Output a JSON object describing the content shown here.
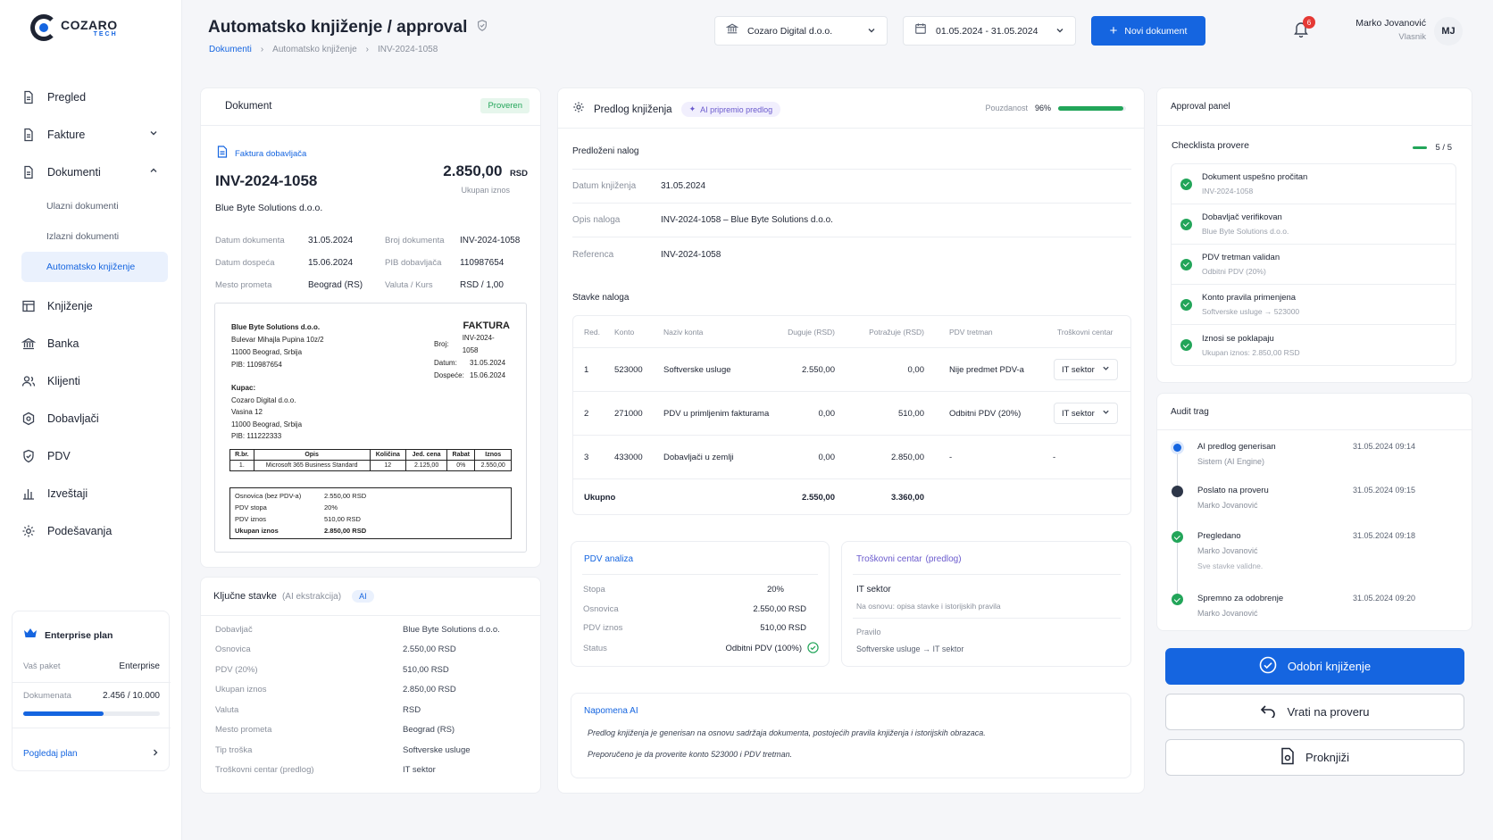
{
  "brand": {
    "name": "COZARO",
    "sub": "TECH"
  },
  "sidebar": {
    "items": [
      {
        "label": "Pregled",
        "icon": "file-icon"
      },
      {
        "label": "Fakture",
        "icon": "file-icon"
      },
      {
        "label": "Dokumenti",
        "icon": "file-icon"
      },
      {
        "label": "Knjiženje",
        "icon": "ledger-icon"
      },
      {
        "label": "Banka",
        "icon": "bank-icon"
      },
      {
        "label": "Klijenti",
        "icon": "users-icon"
      },
      {
        "label": "Dobavljači",
        "icon": "supplier-icon"
      },
      {
        "label": "PDV",
        "icon": "shield-icon"
      },
      {
        "label": "Izveštaji",
        "icon": "chart-icon"
      },
      {
        "label": "Podešavanja",
        "icon": "gear-icon"
      }
    ],
    "sub": [
      "Ulazni dokumenti",
      "Izlazni dokumenti",
      "Automatsko knjiženje"
    ],
    "plan": {
      "title": "Enterprise plan",
      "pkg_label": "Vaš paket",
      "pkg_value": "Enterprise",
      "docs_label": "Dokumenata",
      "docs_value": "2.456 / 10.000",
      "docs_fraction": 0.2456,
      "link": "Pogledaj plan"
    }
  },
  "header": {
    "title": "Automatsko knjiženje / approval",
    "breadcrumb": [
      "Dokumenti",
      "Automatsko knjiženje",
      "INV-2024-1058"
    ],
    "company": "Cozaro Digital d.o.o.",
    "period": "01.05.2024 - 31.05.2024",
    "new_doc": "Novi dokument",
    "notif_count": "6",
    "user_name": "Marko Jovanović",
    "user_role": "Vlasnik",
    "user_initials": "MJ"
  },
  "doc": {
    "title": "Dokument",
    "badge": "Proveren",
    "type": "Faktura dobavljača",
    "number": "INV-2024-1058",
    "amount": "2.850,00",
    "currency": "RSD",
    "amount_label": "Ukupan iznos",
    "supplier": "Blue Byte Solutions d.o.o.",
    "fields": [
      [
        "Datum dokumenta",
        "31.05.2024",
        "Broj dokumenta",
        "INV-2024-1058"
      ],
      [
        "Datum dospeća",
        "15.06.2024",
        "PIB dobavljača",
        "110987654"
      ],
      [
        "Mesto prometa",
        "Beograd (RS)",
        "Valuta / Kurs",
        "RSD / 1,00"
      ]
    ],
    "invoice": {
      "seller": "Blue Byte Solutions d.o.o.",
      "addr1": "Bulevar Mihajla Pupina 10z/2",
      "addr2": "11000 Beograd, Srbija",
      "pib": "PIB: 110987654",
      "title": "FAKTURA",
      "meta": [
        [
          "Broj:",
          "INV-2024-1058"
        ],
        [
          "Datum:",
          "31.05.2024"
        ],
        [
          "Dospeće:",
          "15.06.2024"
        ]
      ],
      "buyer_label": "Kupac:",
      "buyer": "Cozaro Digital d.o.o.",
      "baddr1": "Vasina 12",
      "baddr2": "11000 Beograd, Srbija",
      "bpib": "PIB: 111222333",
      "cols": [
        "R.br.",
        "Opis",
        "Količina",
        "Jed. cena",
        "Rabat",
        "Iznos"
      ],
      "row": [
        "1.",
        "Microsoft 365 Business Standard",
        "12",
        "2.125,00",
        "0%",
        "2.550,00"
      ],
      "totals": [
        [
          "Osnovica (bez PDV-a)",
          "2.550,00  RSD"
        ],
        [
          "PDV stopa",
          "20%"
        ],
        [
          "PDV iznos",
          "510,00  RSD"
        ],
        [
          "Ukupan iznos",
          "2.850,00  RSD"
        ]
      ]
    }
  },
  "key": {
    "title": "Ključne stavke",
    "sub": "(AI ekstrakcija)",
    "badge": "AI",
    "rows": [
      [
        "Dobavljač",
        "Blue Byte Solutions d.o.o."
      ],
      [
        "Osnovica",
        "2.550,00  RSD"
      ],
      [
        "PDV (20%)",
        "510,00  RSD"
      ],
      [
        "Ukupan iznos",
        "2.850,00  RSD"
      ],
      [
        "Valuta",
        "RSD"
      ],
      [
        "Mesto prometa",
        "Beograd (RS)"
      ],
      [
        "Tip troška",
        "Softverske usluge"
      ],
      [
        "Troškovni centar (predlog)",
        "IT sektor"
      ]
    ]
  },
  "proposal": {
    "title": "Predlog knjiženja",
    "ai_badge": "AI pripremio predlog",
    "conf_label": "Pouzdanost",
    "conf_value": "96%",
    "conf_fraction": 0.96,
    "order_title": "Predloženi nalog",
    "order": [
      [
        "Datum knjiženja",
        "31.05.2024"
      ],
      [
        "Opis naloga",
        "INV-2024-1058 – Blue Byte Solutions d.o.o."
      ],
      [
        "Referenca",
        "INV-2024-1058"
      ]
    ],
    "items_title": "Stavke naloga",
    "cols": [
      "Red.",
      "Konto",
      "Naziv konta",
      "Duguje  (RSD)",
      "Potražuje  (RSD)",
      "PDV tretman",
      "Troškovni centar"
    ],
    "rows": [
      [
        "1",
        "523000",
        "Softverske usluge",
        "2.550,00",
        "0,00",
        "Nije predmet PDV-a",
        "IT sektor"
      ],
      [
        "2",
        "271000",
        "PDV u primljenim fakturama",
        "0,00",
        "510,00",
        "Odbitni PDV (20%)",
        "IT sektor"
      ],
      [
        "3",
        "433000",
        "Dobavljači u zemlji",
        "0,00",
        "2.850,00",
        "-",
        "-"
      ]
    ],
    "total_label": "Ukupno",
    "total_debit": "2.550,00",
    "total_credit": "3.360,00"
  },
  "vat": {
    "title": "PDV analiza",
    "rows": [
      [
        "Stopa",
        "20%"
      ],
      [
        "Osnovica",
        "2.550,00  RSD"
      ],
      [
        "PDV iznos",
        "510,00  RSD"
      ],
      [
        "Status",
        "Odbitni PDV (100%)"
      ]
    ]
  },
  "cost": {
    "title": "Troškovni centar",
    "title_sub": "(predlog)",
    "name": "IT sektor",
    "basis": "Na osnovu: opisa stavke i istorijskih pravila",
    "rule_label": "Pravilo",
    "rule": "Softverske usluge → IT sektor"
  },
  "note": {
    "title": "Napomena AI",
    "l1": "Predlog knjiženja je generisan na osnovu sadržaja dokumenta, postojećih pravila knjiženja i istorijskih obrazaca.",
    "l2": "Preporučeno je da proverite konto 523000 i PDV tretman."
  },
  "approval": {
    "title": "Approval panel",
    "checklist": "Checklista provere",
    "count": "5 / 5",
    "checks": [
      [
        "Dokument uspešno pročitan",
        "INV-2024-1058"
      ],
      [
        "Dobavljač verifikovan",
        "Blue Byte Solutions d.o.o."
      ],
      [
        "PDV tretman validan",
        "Odbitni PDV (20%)"
      ],
      [
        "Konto pravila primenjena",
        "Softverske usluge → 523000"
      ],
      [
        "Iznosi se poklapaju",
        "Ukupan iznos: 2.850,00 RSD"
      ]
    ]
  },
  "audit": {
    "title": "Audit trag",
    "events": [
      {
        "t": "AI predlog generisan",
        "s": "Sistem (AI Engine)",
        "d": "31.05.2024  09:14",
        "n": ""
      },
      {
        "t": "Poslato na proveru",
        "s": "Marko Jovanović",
        "d": "31.05.2024  09:15",
        "n": ""
      },
      {
        "t": "Pregledano",
        "s": "Marko Jovanović",
        "d": "31.05.2024  09:18",
        "n": "Sve stavke validne."
      },
      {
        "t": "Spremno za odobrenje",
        "s": "Marko Jovanović",
        "d": "31.05.2024  09:20",
        "n": ""
      }
    ]
  },
  "actions": {
    "approve": "Odobri knjiženje",
    "return": "Vrati na proveru",
    "post": "Proknjiži"
  }
}
